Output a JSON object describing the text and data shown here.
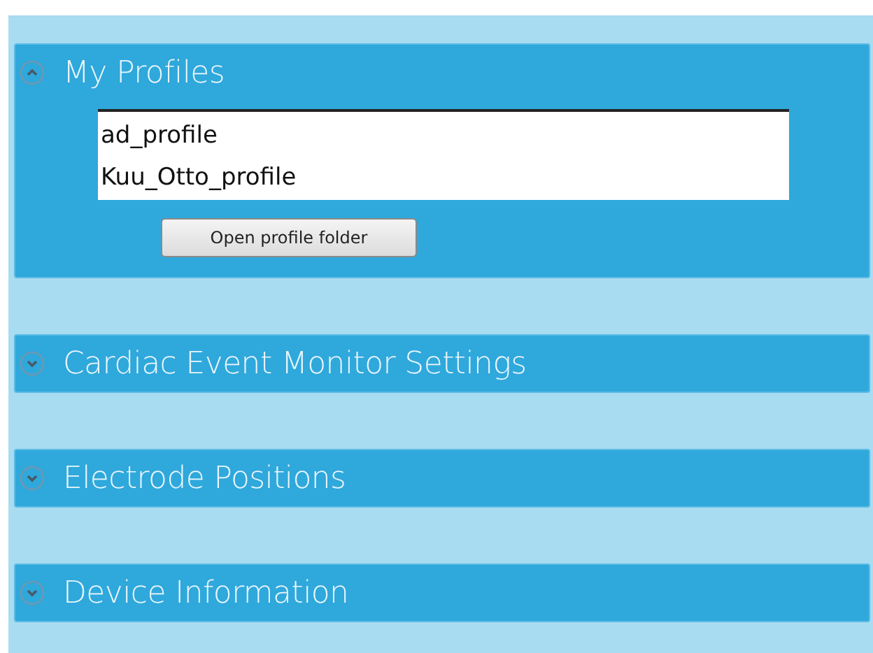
{
  "sections": [
    {
      "title": "My Profiles",
      "expanded": true,
      "profiles": [
        "ad_profile",
        "Kuu_Otto_profile"
      ],
      "button": "Open profile folder"
    },
    {
      "title": "Cardiac Event Monitor Settings",
      "expanded": false
    },
    {
      "title": "Electrode Positions",
      "expanded": false
    },
    {
      "title": "Device Information",
      "expanded": false
    }
  ]
}
